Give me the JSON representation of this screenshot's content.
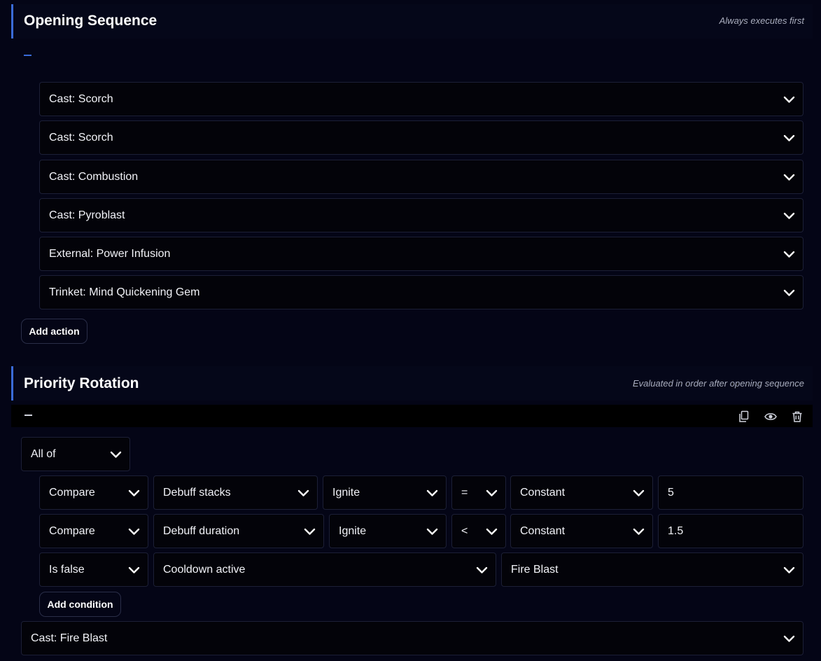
{
  "opening": {
    "title": "Opening Sequence",
    "subtitle": "Always executes first",
    "collapse_icon": "minus-icon",
    "actions": [
      {
        "label": "Cast: Scorch"
      },
      {
        "label": "Cast: Scorch"
      },
      {
        "label": "Cast: Combustion"
      },
      {
        "label": "Cast: Pyroblast"
      },
      {
        "label": "External: Power Infusion"
      },
      {
        "label": "Trinket: Mind Quickening Gem"
      }
    ],
    "add_action_label": "Add action"
  },
  "priority": {
    "title": "Priority Rotation",
    "subtitle": "Evaluated in order after opening sequence",
    "toolbar_icons": [
      "copy-icon",
      "eye-icon",
      "trash-icon"
    ],
    "logic": "All of",
    "conditions": [
      {
        "type": "Compare",
        "metric": "Debuff stacks",
        "target": "Ignite",
        "operator": "=",
        "source": "Constant",
        "value": "5"
      },
      {
        "type": "Compare",
        "metric": "Debuff duration",
        "target": "Ignite",
        "operator": "<",
        "source": "Constant",
        "value": "1.5"
      },
      {
        "type": "Is false",
        "metric": "Cooldown active",
        "target": "Fire Blast"
      }
    ],
    "add_condition_label": "Add condition",
    "action": "Cast: Fire Blast"
  },
  "colors": {
    "background": "#040516",
    "accent": "#3a6bd8",
    "control_bg": "#030309"
  }
}
